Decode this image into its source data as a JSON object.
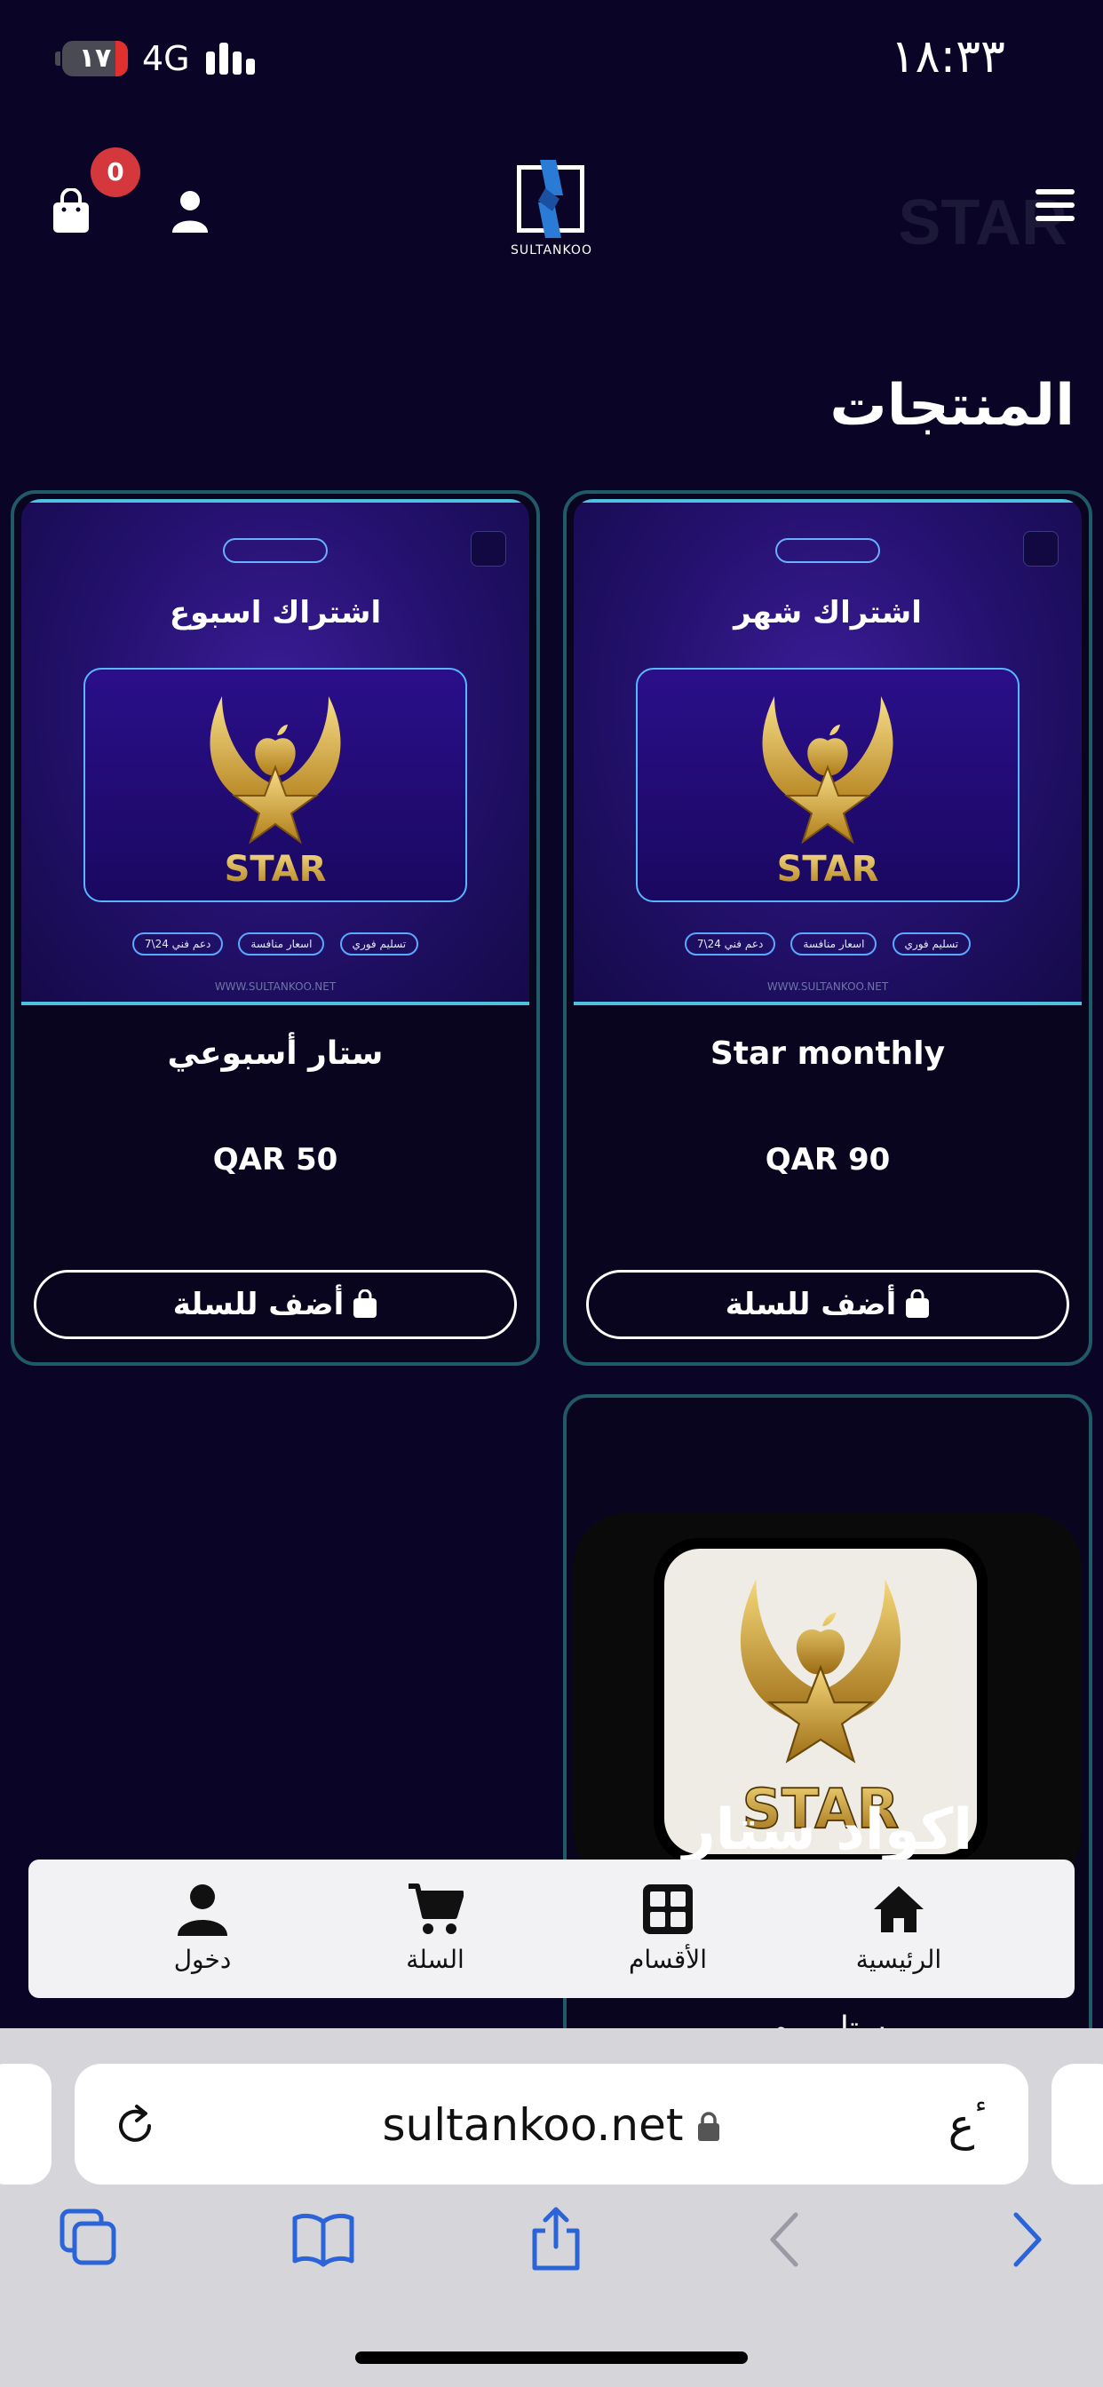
{
  "status_bar": {
    "battery": "١٧",
    "network": "4G",
    "time": "١٨:٣٣"
  },
  "header": {
    "logo_text": "SULTANKOO",
    "watermark": "STAR",
    "cart_count": "0"
  },
  "section_title": "المنتجات",
  "products": [
    {
      "image_title": "اشتراك شهر",
      "image_chips": [
        "تسليم فوري",
        "اسعار منافسة",
        "دعم فني 24\\7"
      ],
      "image_site": "WWW.SULTANKOO.NET",
      "image_emblem_text": "STAR",
      "name": "Star monthly",
      "price": "QAR 90",
      "button": "أضف للسلة"
    },
    {
      "image_title": "اشتراك اسبوع",
      "image_chips": [
        "تسليم فوري",
        "اسعار منافسة",
        "دعم فني 24\\7"
      ],
      "image_site": "WWW.SULTANKOO.NET",
      "image_emblem_text": "STAR",
      "name": "ستار أسبوعي",
      "price": "QAR 50",
      "button": "أضف للسلة"
    },
    {
      "image_emblem_text": "STAR",
      "image_title": "اكواد ستار",
      "name": "ستار يوم"
    }
  ],
  "bottom_nav": {
    "home": "الرئيسية",
    "categories": "الأقسام",
    "cart": "السلة",
    "login": "دخول"
  },
  "browser": {
    "url": "sultankoo.net",
    "text_size": "ٴع"
  },
  "colors": {
    "background": "#0a0526",
    "card_border": "#1f5a66",
    "badge": "#d4373c",
    "nav_bg": "#f2f2f4",
    "toolbar_icons": "#2a64d8"
  }
}
